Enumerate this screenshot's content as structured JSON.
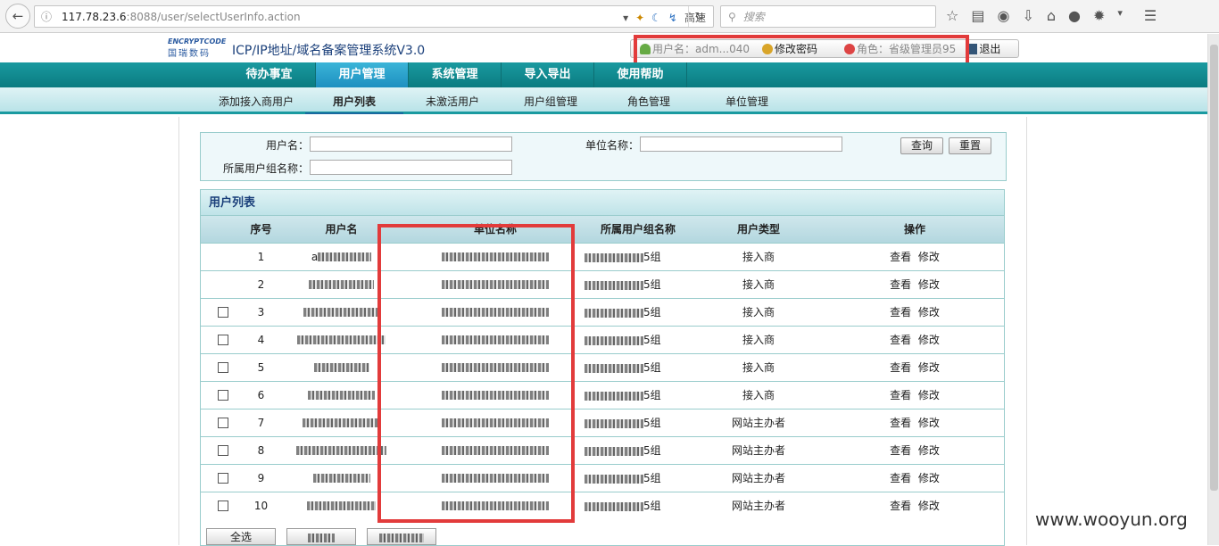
{
  "browser": {
    "url_host": "117.78.23.6",
    "url_rest": ":8088/user/selectUserInfo.action",
    "speed_label": "高速",
    "search_placeholder": "搜索"
  },
  "header": {
    "logo_mark": "ENCRYPTCODE",
    "logo_cn": "国瑞数码",
    "title": "ICP/IP地址/域名备案管理系统V3.0",
    "username_label": "用户名：adm...040",
    "change_password": "修改密码",
    "role_label": "角色：省级管理员95",
    "logout": "退出"
  },
  "menu": {
    "tabs": [
      {
        "label": "待办事宜"
      },
      {
        "label": "用户管理"
      },
      {
        "label": "系统管理"
      },
      {
        "label": "导入导出"
      },
      {
        "label": "使用帮助"
      }
    ]
  },
  "submenu": {
    "items": [
      {
        "label": "添加接入商用户"
      },
      {
        "label": "用户列表"
      },
      {
        "label": "未激活用户"
      },
      {
        "label": "用户组管理"
      },
      {
        "label": "角色管理"
      },
      {
        "label": "单位管理"
      }
    ]
  },
  "search": {
    "username_label": "用户名：",
    "unit_label": "单位名称：",
    "group_label": "所属用户组名称：",
    "query_btn": "查询",
    "reset_btn": "重置"
  },
  "list": {
    "title": "用户列表",
    "columns": [
      "序号",
      "用户名",
      "单位名称",
      "所属用户组名称",
      "用户类型",
      "操作"
    ],
    "view_label": "查看",
    "edit_label": "修改",
    "rows": [
      {
        "no": "1",
        "user_prefix": "a",
        "group_suffix": "5组",
        "type": "接入商"
      },
      {
        "no": "2",
        "user_prefix": "",
        "group_suffix": "5组",
        "type": "接入商"
      },
      {
        "no": "3",
        "user_prefix": "",
        "group_suffix": "5组",
        "type": "接入商"
      },
      {
        "no": "4",
        "user_prefix": "",
        "group_suffix": "5组",
        "type": "接入商"
      },
      {
        "no": "5",
        "user_prefix": "",
        "group_suffix": "5组",
        "type": "接入商"
      },
      {
        "no": "6",
        "user_prefix": "",
        "group_suffix": "5组",
        "type": "接入商"
      },
      {
        "no": "7",
        "user_prefix": "",
        "group_suffix": "5组",
        "type": "网站主办者"
      },
      {
        "no": "8",
        "user_prefix": "",
        "group_suffix": "5组",
        "type": "网站主办者"
      },
      {
        "no": "9",
        "user_prefix": "",
        "group_suffix": "5组",
        "type": "网站主办者"
      },
      {
        "no": "10",
        "user_prefix": "",
        "group_suffix": "5组",
        "type": "网站主办者"
      }
    ],
    "select_all": "全选"
  },
  "watermark": "www.wooyun.org"
}
